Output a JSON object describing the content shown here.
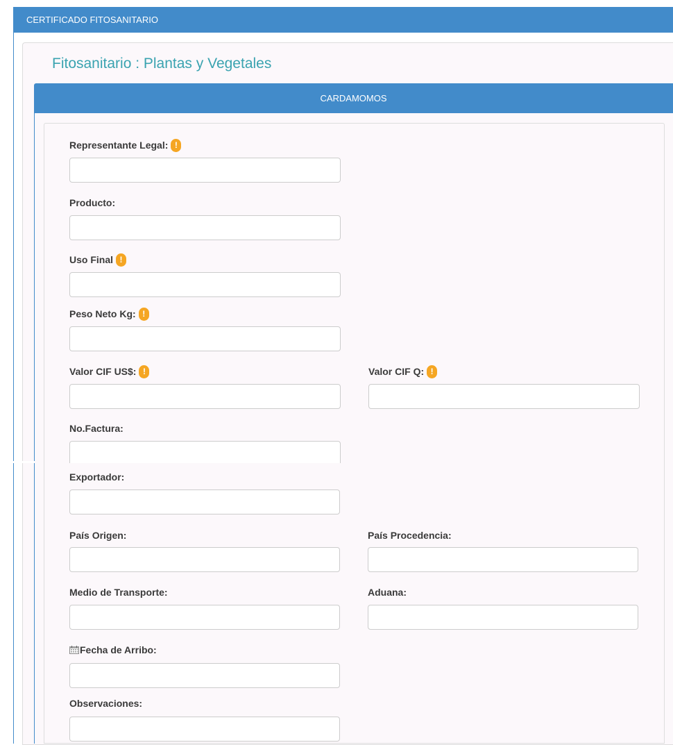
{
  "header": {
    "title": "CERTIFICADO FITOSANITARIO"
  },
  "page": {
    "title": "Fitosanitario : Plantas y Vegetales"
  },
  "section": {
    "title": "CARDAMOMOS"
  },
  "warning_glyph": "!",
  "form": {
    "representante_legal": {
      "label": "Representante Legal:",
      "value": ""
    },
    "producto": {
      "label": "Producto:",
      "value": ""
    },
    "uso_final": {
      "label": "Uso Final",
      "value": ""
    },
    "peso_neto": {
      "label": "Peso Neto Kg:",
      "value": ""
    },
    "valor_cif_usd": {
      "label": "Valor CIF US$:",
      "value": ""
    },
    "valor_cif_q": {
      "label": "Valor CIF Q:",
      "value": ""
    },
    "no_factura": {
      "label": "No.Factura:",
      "value": ""
    },
    "exportador": {
      "label": "Exportador:",
      "value": ""
    },
    "pais_origen": {
      "label": "País Origen:",
      "value": ""
    },
    "pais_procedencia": {
      "label": "País Procedencia:",
      "value": ""
    },
    "medio_transporte": {
      "label": "Medio de Transporte:",
      "value": ""
    },
    "aduana": {
      "label": "Aduana:",
      "value": ""
    },
    "fecha_arribo": {
      "label": "Fecha de Arribo:",
      "value": ""
    },
    "observaciones": {
      "label": "Observaciones:",
      "value": ""
    }
  },
  "colors": {
    "primary": "#428bca",
    "title": "#3aa3b0",
    "warning": "#f5a623",
    "panel_bg": "#fcf8fb"
  },
  "icons": {
    "required": "exclamation-badge-icon",
    "date": "calendar-icon"
  }
}
